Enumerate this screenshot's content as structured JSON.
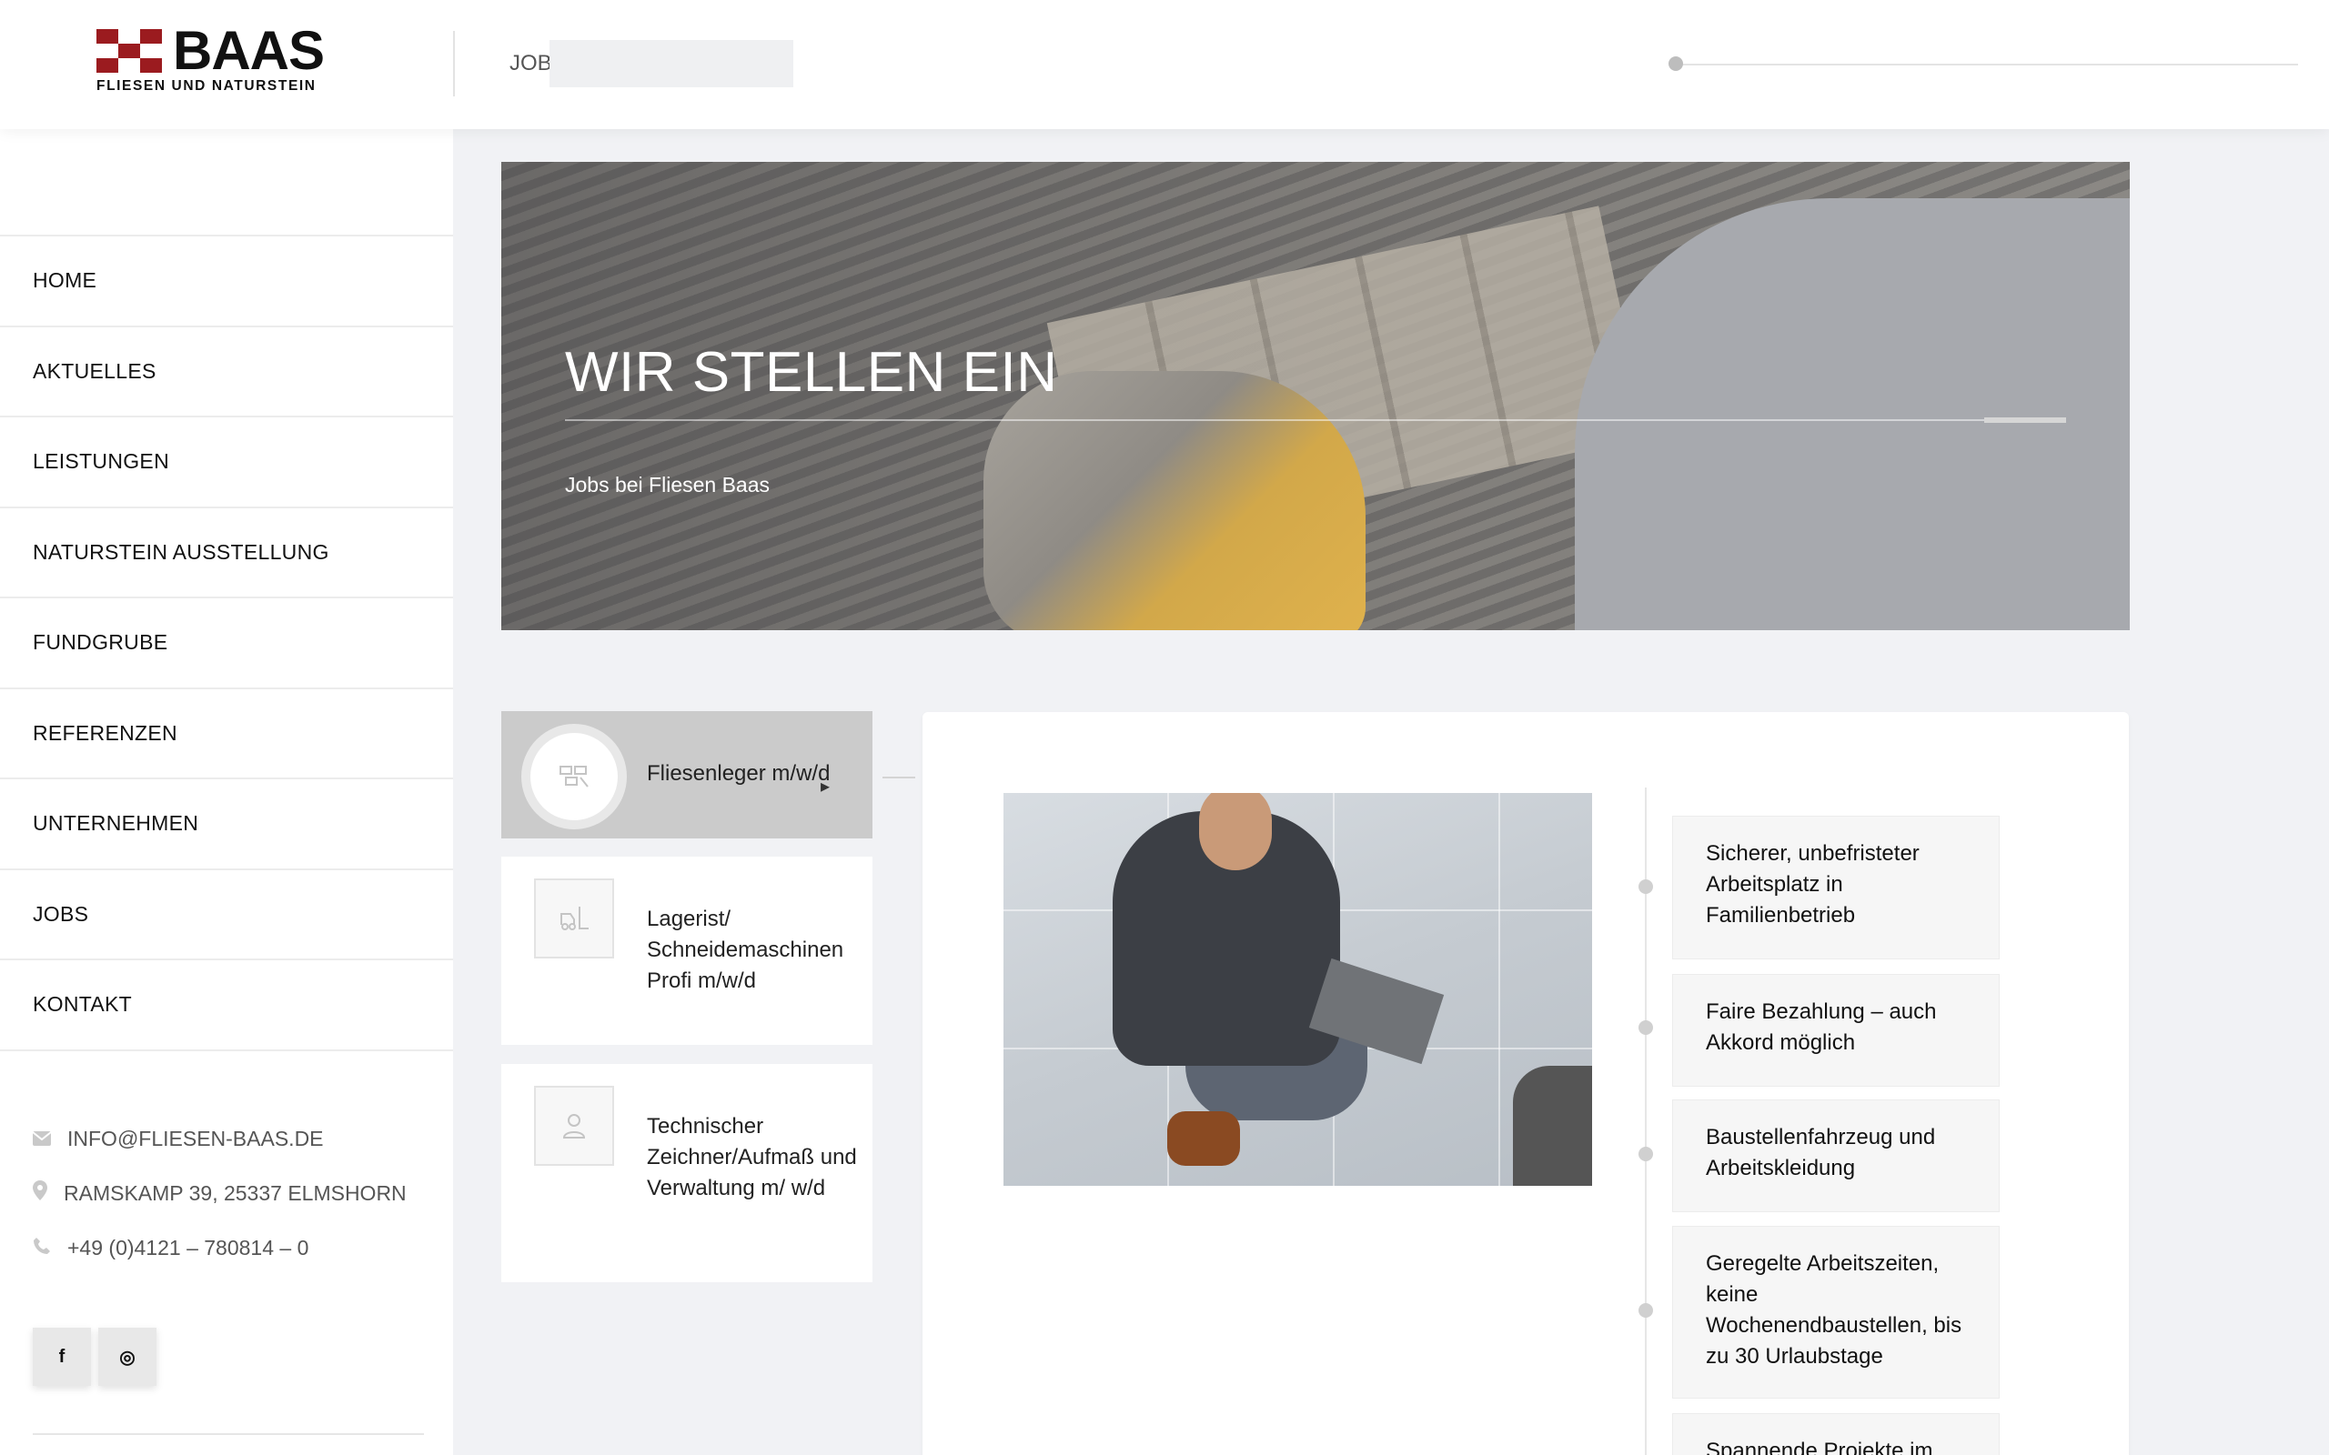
{
  "brand": {
    "name": "BAAS",
    "tagline": "FLIESEN UND NATURSTEIN",
    "color": "#9b1b1f"
  },
  "header": {
    "breadcrumb": "JOBS",
    "search_value": ""
  },
  "nav": {
    "items": [
      {
        "label": "HOME"
      },
      {
        "label": "AKTUELLES"
      },
      {
        "label": "LEISTUNGEN"
      },
      {
        "label": "NATURSTEIN AUSSTELLUNG"
      },
      {
        "label": "FUNDGRUBE"
      },
      {
        "label": "REFERENZEN"
      },
      {
        "label": "UNTERNEHMEN"
      },
      {
        "label": "JOBS"
      },
      {
        "label": "KONTAKT"
      }
    ]
  },
  "contact": {
    "email": "INFO@FLIESEN-BAAS.DE",
    "address": "RAMSKAMP 39, 25337 ELMSHORN",
    "phone": "+49 (0)4121 – 780814 – 0"
  },
  "social": {
    "facebook": "f",
    "instagram": "◎"
  },
  "hero": {
    "title": "WIR STELLEN EIN",
    "subtitle": "Jobs bei Fliesen Baas"
  },
  "jobs": {
    "tabs": [
      {
        "label": "Fliesenleger m/w/d",
        "icon": "tiles-icon",
        "active": true
      },
      {
        "label": "Lagerist/ Schneidemaschinen Profi m/w/d",
        "icon": "forklift-icon",
        "active": false
      },
      {
        "label": "Technischer Zeichner/Aufmaß und Verwaltung m/ w/d",
        "icon": "drafter-icon",
        "active": false
      }
    ]
  },
  "benefits": [
    "Sicherer, unbefristeter Arbeitsplatz in Familienbetrieb",
    "Faire Bezahlung – auch Akkord möglich",
    "Baustellenfahrzeug und Arbeitskleidung",
    "Geregelte Arbeitszeiten, keine Wochenendbaustellen, bis zu 30 Urlaubstage",
    "Spannende Projekte im"
  ]
}
